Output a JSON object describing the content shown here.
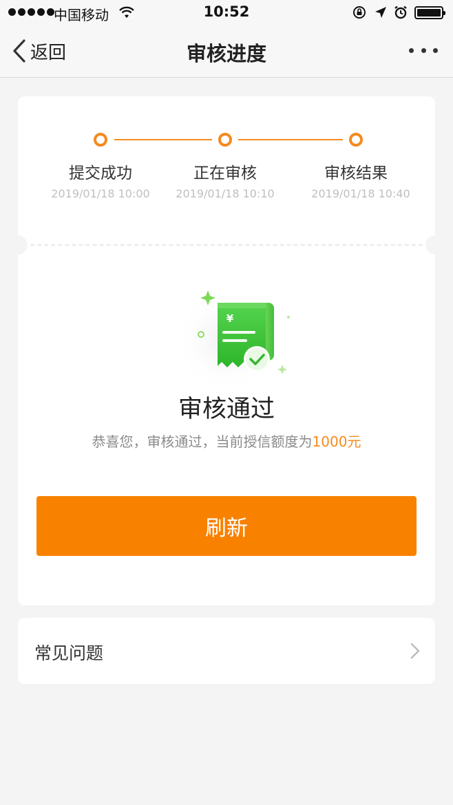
{
  "status_bar": {
    "carrier": "中国移动",
    "time": "10:52",
    "icons": [
      "signal-dots-icon",
      "wifi-icon",
      "orientation-lock-icon",
      "location-arrow-icon",
      "alarm-icon",
      "battery-icon"
    ]
  },
  "nav": {
    "back_label": "返回",
    "back_icon": "chevron-left-icon",
    "title": "审核进度",
    "more_icon": "more-dots-icon"
  },
  "progress": {
    "accent_color": "#f58a1e",
    "steps": [
      {
        "label": "提交成功",
        "time": "2019/01/18 10:00"
      },
      {
        "label": "正在审核",
        "time": "2019/01/18 10:10"
      },
      {
        "label": "审核结果",
        "time": "2019/01/18 10:40"
      }
    ]
  },
  "result": {
    "illustration_icon": "receipt-approved-icon",
    "title": "审核通过",
    "desc_prefix": "恭喜您，审核通过，当前授信额度为",
    "amount": "1000元",
    "amount_color": "#f58a1e"
  },
  "actions": {
    "refresh_label": "刷新",
    "refresh_color": "#f98100"
  },
  "faq": {
    "label": "常见问题",
    "chevron_icon": "chevron-right-icon"
  }
}
